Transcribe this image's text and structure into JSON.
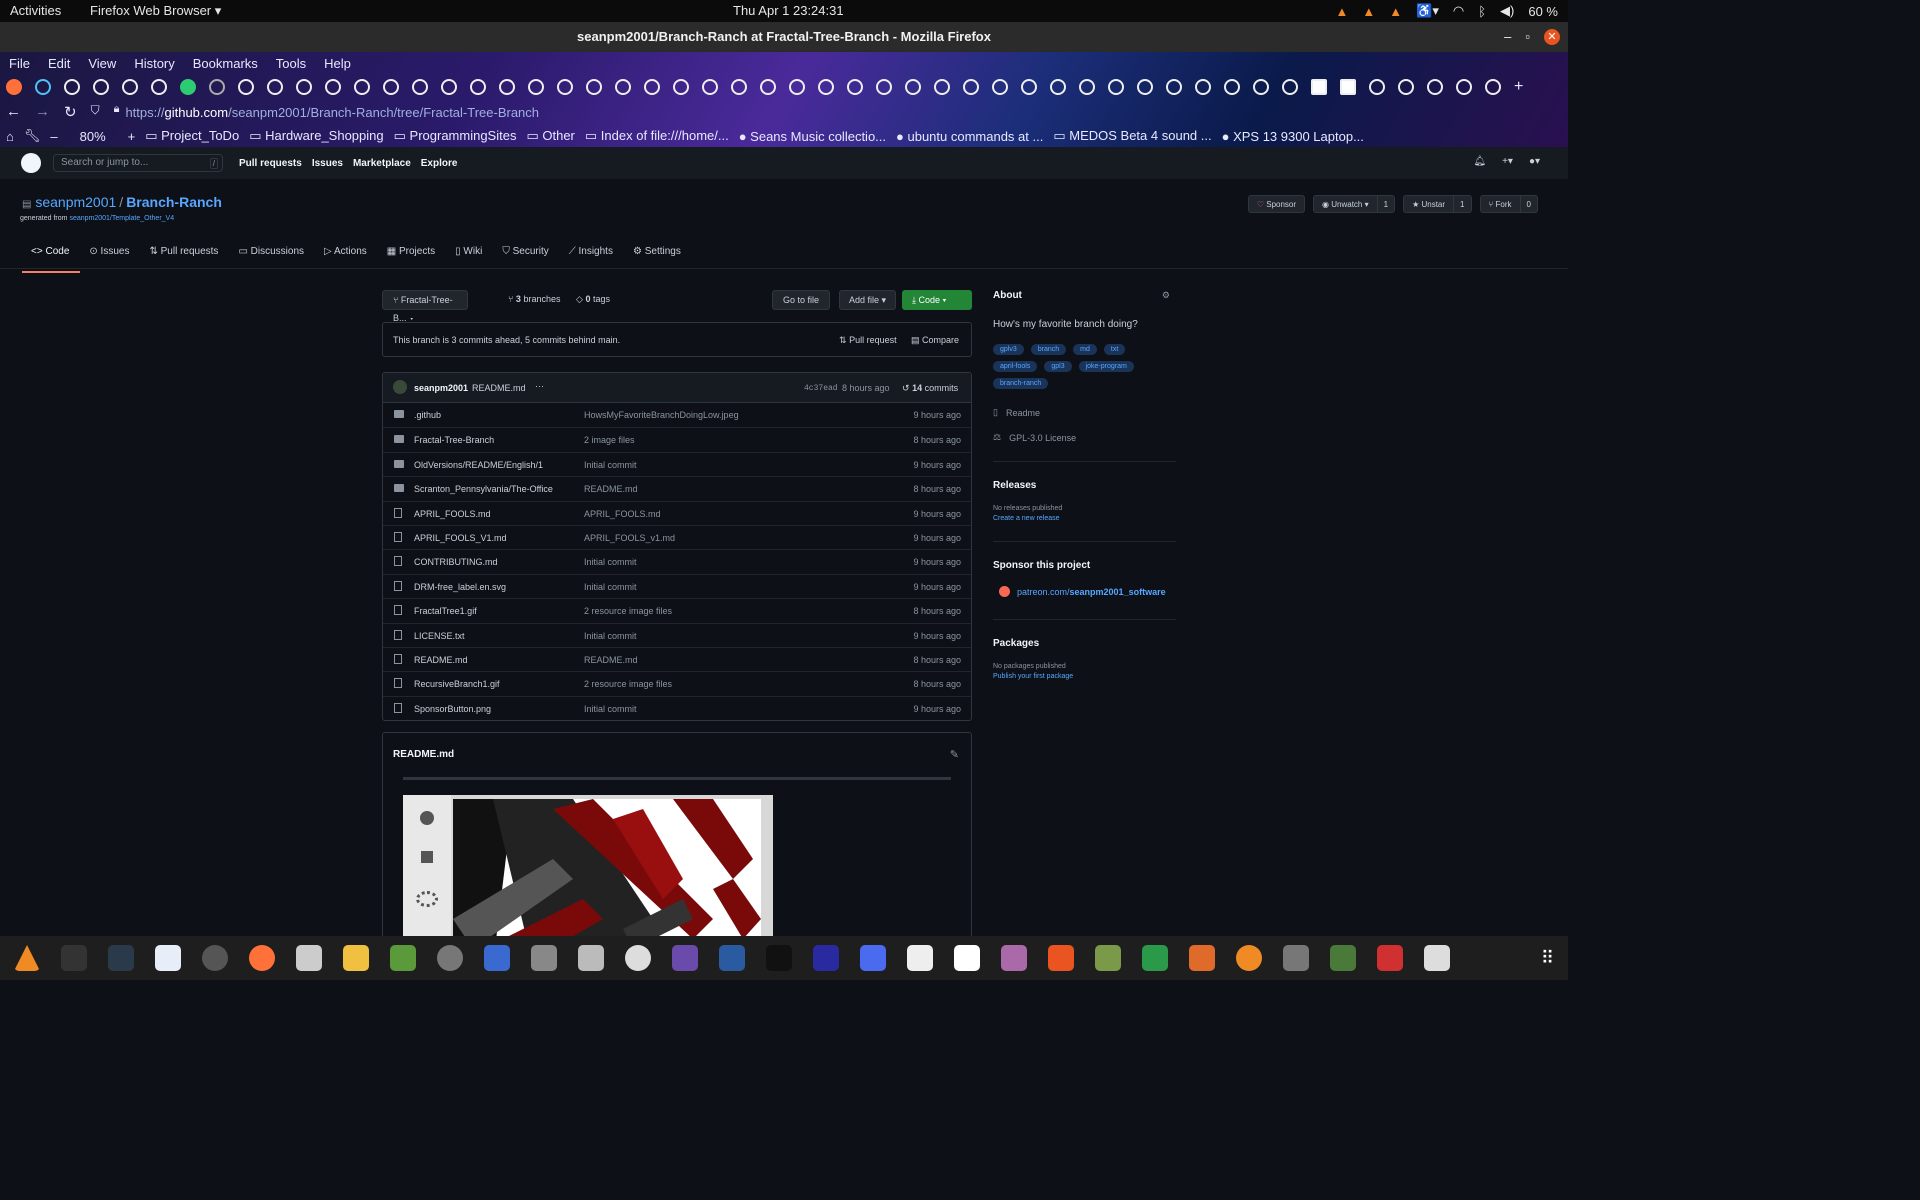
{
  "system_bar": {
    "activities": "Activities",
    "app_menu": "Firefox Web Browser ▾",
    "clock": "Thu Apr 1  23:24:31",
    "battery": "60 %"
  },
  "window": {
    "title": "seanpm2001/Branch-Ranch at Fractal-Tree-Branch - Mozilla Firefox"
  },
  "menu": [
    "File",
    "Edit",
    "View",
    "History",
    "Bookmarks",
    "Tools",
    "Help"
  ],
  "url": {
    "prefix": "https://",
    "domain": "github.com",
    "path": "/seanpm2001/Branch-Ranch/tree/Fractal-Tree-Branch"
  },
  "bookmarks": {
    "zoom": "80%",
    "items": [
      "Project_ToDo",
      "Hardware_Shopping",
      "ProgrammingSites",
      "Other",
      "Index of file:///home/...",
      "Seans Music collectio...",
      "ubuntu commands at ...",
      "MEDOS Beta 4 sound ...",
      "XPS 13 9300 Laptop..."
    ]
  },
  "gh_header": {
    "search_placeholder": "Search or jump to...",
    "search_key": "/",
    "nav": [
      "Pull requests",
      "Issues",
      "Marketplace",
      "Explore"
    ]
  },
  "repo": {
    "owner": "seanpm2001",
    "name": "Branch-Ranch",
    "generated_from_label": "generated from",
    "generated_from_link": "seanpm2001/Template_Other_V4",
    "sponsor": "Sponsor",
    "unwatch": "Unwatch ▾",
    "watch_count": "1",
    "unstar": "Unstar",
    "star_count": "1",
    "fork": "Fork",
    "fork_count": "0",
    "tabs": [
      "Code",
      "Issues",
      "Pull requests",
      "Discussions",
      "Actions",
      "Projects",
      "Wiki",
      "Security",
      "Insights",
      "Settings"
    ]
  },
  "toolbar": {
    "branch": "Fractal-Tree-B... ▾",
    "branches_count": "3",
    "branches_label": "branches",
    "tags_count": "0",
    "tags_label": "tags",
    "go_to_file": "Go to file",
    "add_file": "Add file ▾",
    "code": "Code ▾"
  },
  "ahead_behind": {
    "text": "This branch is 3 commits ahead, 5 commits behind main.",
    "pull_request": "Pull request",
    "compare": "Compare"
  },
  "latest_commit": {
    "author": "seanpm2001",
    "message": "README.md",
    "dots": "···",
    "sha": "4c37ead",
    "age": "8 hours ago",
    "commit_count": "14",
    "commit_label": "commits"
  },
  "files": [
    {
      "name": ".github",
      "type": "dir",
      "commit": "HowsMyFavoriteBranchDoingLow.jpeg",
      "age": "9 hours ago"
    },
    {
      "name": "Fractal-Tree-Branch",
      "type": "dir",
      "commit": "2 image files",
      "age": "8 hours ago"
    },
    {
      "name": "OldVersions/README/English/1",
      "type": "dir",
      "commit": "Initial commit",
      "age": "9 hours ago"
    },
    {
      "name": "Scranton_Pennsylvania/The-Office",
      "type": "dir",
      "commit": "README.md",
      "age": "8 hours ago"
    },
    {
      "name": "APRIL_FOOLS.md",
      "type": "file",
      "commit": "APRIL_FOOLS.md",
      "age": "9 hours ago"
    },
    {
      "name": "APRIL_FOOLS_V1.md",
      "type": "file",
      "commit": "APRIL_FOOLS_v1.md",
      "age": "9 hours ago"
    },
    {
      "name": "CONTRIBUTING.md",
      "type": "file",
      "commit": "Initial commit",
      "age": "9 hours ago"
    },
    {
      "name": "DRM-free_label.en.svg",
      "type": "file",
      "commit": "Initial commit",
      "age": "9 hours ago"
    },
    {
      "name": "FractalTree1.gif",
      "type": "file",
      "commit": "2 resource image files",
      "age": "8 hours ago"
    },
    {
      "name": "LICENSE.txt",
      "type": "file",
      "commit": "Initial commit",
      "age": "9 hours ago"
    },
    {
      "name": "README.md",
      "type": "file",
      "commit": "README.md",
      "age": "8 hours ago"
    },
    {
      "name": "RecursiveBranch1.gif",
      "type": "file",
      "commit": "2 resource image files",
      "age": "8 hours ago"
    },
    {
      "name": "SponsorButton.png",
      "type": "file",
      "commit": "Initial commit",
      "age": "9 hours ago"
    }
  ],
  "readme": {
    "title": "README.md"
  },
  "about": {
    "heading": "About",
    "description": "How's my favorite branch doing?",
    "topics": [
      "gplv3",
      "branch",
      "md",
      "txt",
      "april-fools",
      "gpl3",
      "joke-program",
      "branch-ranch"
    ],
    "readme": "Readme",
    "license": "GPL-3.0 License"
  },
  "releases": {
    "heading": "Releases",
    "none": "No releases published",
    "create": "Create a new release"
  },
  "sponsor": {
    "heading": "Sponsor this project",
    "link_prefix": "patreon.com/",
    "link_user": "seanpm2001_software"
  },
  "packages": {
    "heading": "Packages",
    "none": "No packages published",
    "publish": "Publish your first package"
  }
}
